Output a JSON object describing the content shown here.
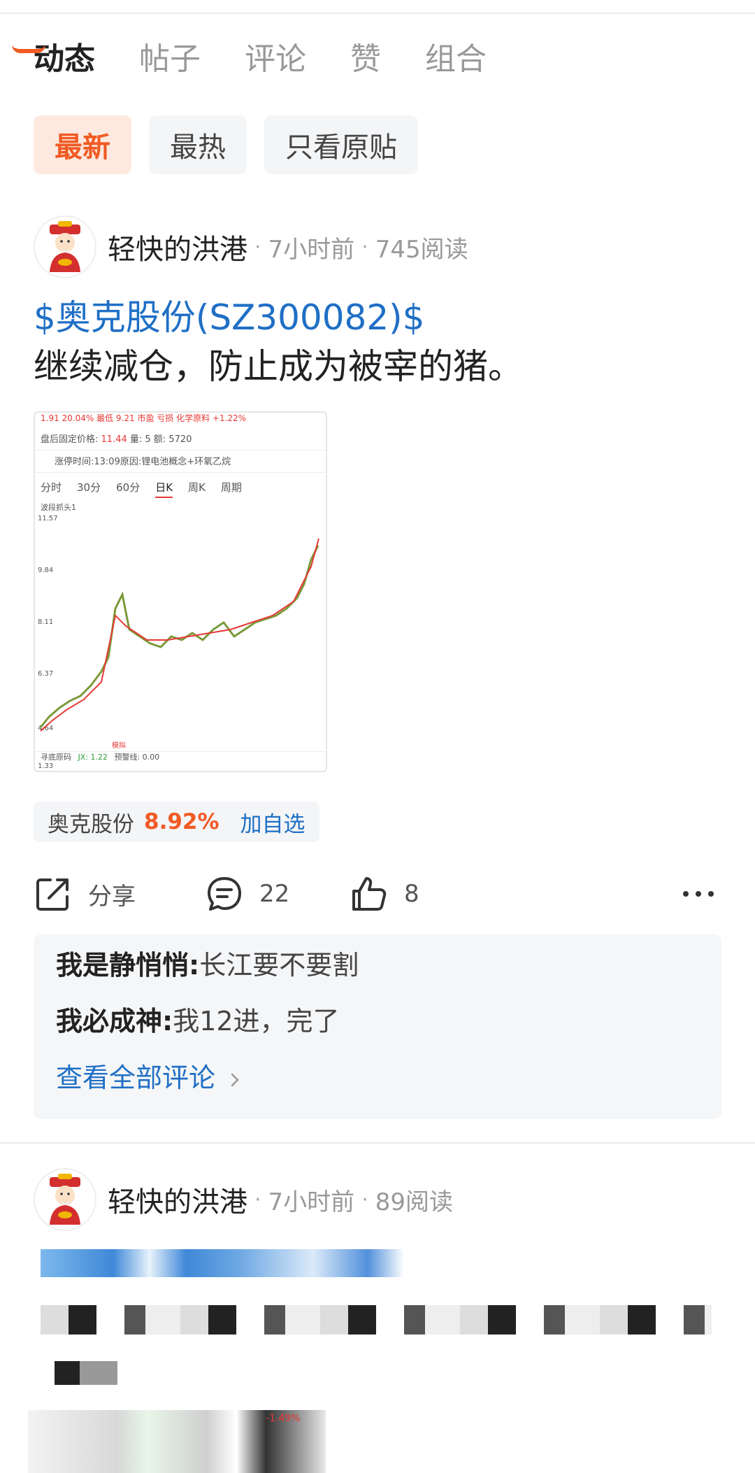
{
  "tabs": [
    {
      "label": "动态"
    },
    {
      "label": "帖子"
    },
    {
      "label": "评论"
    },
    {
      "label": "赞"
    },
    {
      "label": "组合"
    }
  ],
  "filters": [
    {
      "label": "最新"
    },
    {
      "label": "最热"
    },
    {
      "label": "只看原贴"
    }
  ],
  "post1": {
    "author": "轻快的洪港",
    "time": "7小时前",
    "reads": "745阅读",
    "stock_link": "$奥克股份(SZ300082)$",
    "text": "继续减仓，防止成为被宰的猪。",
    "image": {
      "row1": "1.91 20.04%   最低   9.21 市盈   亏损   化学原料 +1.22%",
      "row2_label": "盘后固定价格:",
      "row2_price": "11.44",
      "row2_rest": "量:  5   额:  5720",
      "row3": "涨停时间:13:09原因:锂电池概念+环氧乙烷",
      "periods": [
        "分时",
        "30分",
        "60分",
        "日K",
        "周K",
        "周期"
      ],
      "indicator": "波段抓头1",
      "y_labels": [
        "11.57",
        "9.84",
        "8.11",
        "6.37",
        "4.64"
      ],
      "bottom_labels": {
        "ind2": "寻底原码",
        "jx": "JX: 1.22",
        "warn": "预警线: 0.00",
        "low": "1.33",
        "tag": "模拟"
      }
    },
    "stock_chip": {
      "name": "奥克股份",
      "change": "8.92%",
      "add": "加自选"
    },
    "actions": {
      "share": "分享",
      "comments": "22",
      "likes": "8"
    },
    "comments": [
      {
        "user": "我是静悄悄:",
        "text": "长江要不要割"
      },
      {
        "user": "我必成神:",
        "text": "我12进，完了"
      }
    ],
    "see_all": "查看全部评论"
  },
  "post2": {
    "author": "轻快的洪港",
    "time": "7小时前",
    "reads": "89阅读",
    "image_change": "-1.49%"
  },
  "colors": {
    "accent": "#f15a24",
    "link": "#1f6fc5",
    "chip_bg": "#f4f5f7"
  }
}
